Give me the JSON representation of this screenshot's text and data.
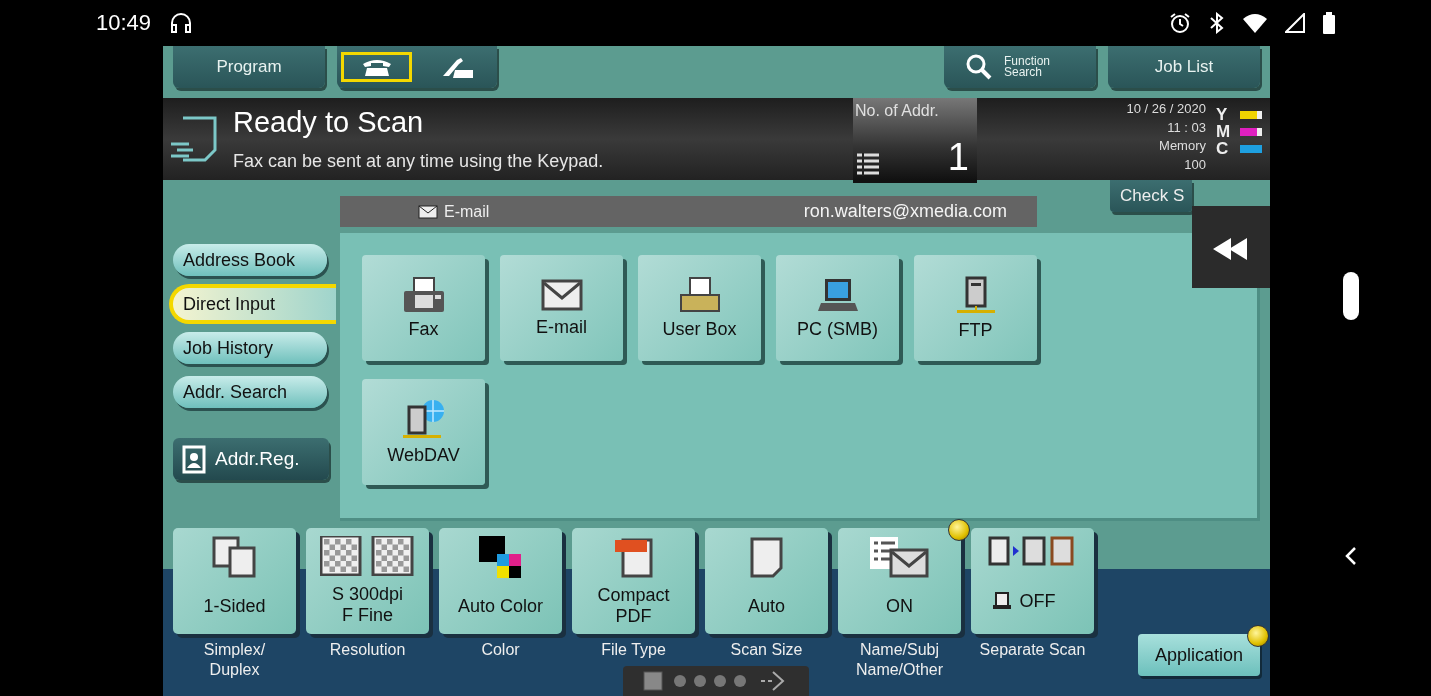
{
  "status_bar": {
    "time": "10:49"
  },
  "toolbar": {
    "program": "Program",
    "modes": [
      {
        "kind": "fax",
        "selected": true
      },
      {
        "kind": "handset",
        "selected": false
      }
    ],
    "function_search": "Function Search",
    "job_list": "Job List"
  },
  "status": {
    "title": "Ready to Scan",
    "message": "Fax can be sent at any time using the Keypad.",
    "addr_count_label": "No. of Addr.",
    "addr_count": "1",
    "date": "10 / 26 / 2020",
    "time": "11 : 03",
    "memory_label": "Memory",
    "memory": "100",
    "toners": [
      {
        "letter": "Y",
        "color": "#f0d400",
        "level": 0.75
      },
      {
        "letter": "M",
        "color": "#e020c0",
        "level": 0.75
      },
      {
        "letter": "C",
        "color": "#1ea0e0",
        "level": 1
      }
    ]
  },
  "nav": [
    {
      "label": "Address Book",
      "selected": false
    },
    {
      "label": "Direct Input",
      "selected": true
    },
    {
      "label": "Job History",
      "selected": false
    },
    {
      "label": "Addr. Search",
      "selected": false
    }
  ],
  "register_button": "Addr.Reg.",
  "destination": {
    "type": "E-mail",
    "address": "ron.walters@xmedia.com"
  },
  "destinations": [
    {
      "kind": "fax",
      "label": "Fax"
    },
    {
      "kind": "email",
      "label": "E-mail"
    },
    {
      "kind": "userbox",
      "label": "User Box"
    },
    {
      "kind": "pc",
      "label": "PC (SMB)"
    },
    {
      "kind": "ftp",
      "label": "FTP"
    },
    {
      "kind": "webdav",
      "label": "WebDAV"
    }
  ],
  "check_button": "Check S",
  "settings": [
    {
      "kind": "duplex",
      "value_lines": [
        "1-Sided"
      ],
      "caption_lines": [
        "Simplex/",
        "Duplex"
      ],
      "notice": false
    },
    {
      "kind": "resolution",
      "value_lines": [
        "S 300dpi",
        "F Fine"
      ],
      "caption_lines": [
        "Resolution"
      ],
      "notice": false
    },
    {
      "kind": "color",
      "value_lines": [
        "Auto Color"
      ],
      "caption_lines": [
        "Color"
      ],
      "notice": false
    },
    {
      "kind": "filetype",
      "value_lines": [
        "Compact",
        "PDF"
      ],
      "caption_lines": [
        "File Type"
      ],
      "notice": false
    },
    {
      "kind": "size",
      "value_lines": [
        "Auto"
      ],
      "caption_lines": [
        "Scan Size"
      ],
      "notice": false
    },
    {
      "kind": "name",
      "value_lines": [
        "ON"
      ],
      "caption_lines": [
        "Name/Subj",
        "Name/Other"
      ],
      "notice": true
    },
    {
      "kind": "separate",
      "value_lines": [
        "OFF"
      ],
      "caption_lines": [
        "Separate Scan"
      ],
      "notice": false
    }
  ],
  "application": {
    "label": "Application",
    "notice": true
  }
}
